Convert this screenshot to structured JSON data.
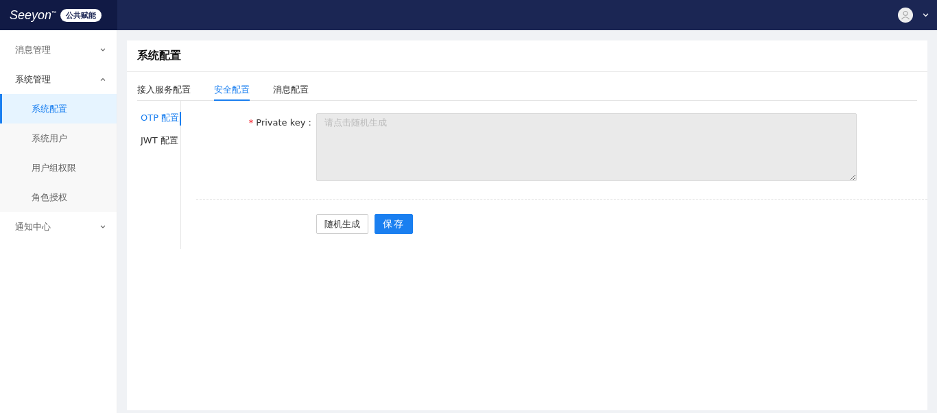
{
  "header": {
    "logo": "Seeyon",
    "logo_mark": "™",
    "badge": "公共赋能"
  },
  "sidebar": {
    "menus": [
      {
        "label": "消息管理",
        "expanded": false
      },
      {
        "label": "系统管理",
        "expanded": true,
        "children": [
          {
            "label": "系统配置",
            "selected": true
          },
          {
            "label": "系统用户",
            "selected": false
          },
          {
            "label": "用户组权限",
            "selected": false
          },
          {
            "label": "角色授权",
            "selected": false
          }
        ]
      },
      {
        "label": "通知中心",
        "expanded": false
      }
    ]
  },
  "page": {
    "title": "系统配置",
    "tabs": [
      {
        "label": "接入服务配置",
        "selected": false
      },
      {
        "label": "安全配置",
        "selected": true
      },
      {
        "label": "消息配置",
        "selected": false
      }
    ],
    "side_tabs": [
      {
        "label": "OTP 配置",
        "selected": true
      },
      {
        "label": "JWT 配置",
        "selected": false
      }
    ],
    "form": {
      "required_mark": "*",
      "label": "Private key :",
      "placeholder": "请点击随机生成",
      "disabled": true
    },
    "buttons": [
      {
        "label": "随机生成",
        "kind": "default"
      },
      {
        "label": "保存",
        "kind": "primary"
      }
    ]
  }
}
